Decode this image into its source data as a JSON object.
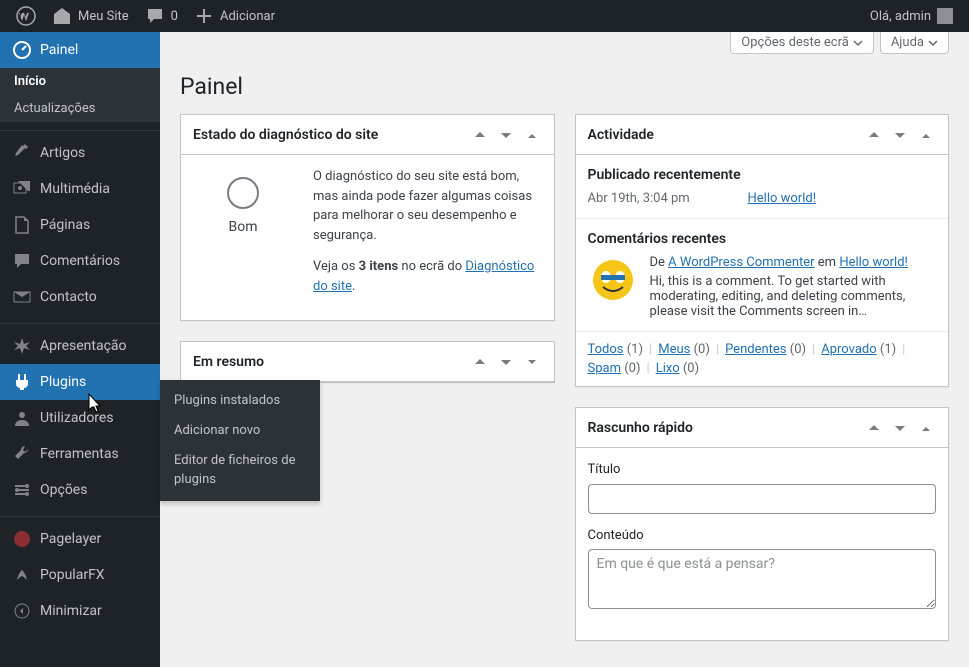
{
  "adminbar": {
    "site_name": "Meu Site",
    "comments_count": "0",
    "add_new": "Adicionar",
    "greeting": "Olá, admin"
  },
  "menu": {
    "dashboard": "Painel",
    "dashboard_sub": {
      "home": "Início",
      "updates": "Actualizações"
    },
    "posts": "Artigos",
    "media": "Multimédia",
    "pages": "Páginas",
    "comments": "Comentários",
    "contact": "Contacto",
    "appearance": "Apresentação",
    "plugins": "Plugins",
    "plugins_sub": {
      "installed": "Plugins instalados",
      "add": "Adicionar novo",
      "editor": "Editor de ficheiros de plugins"
    },
    "users": "Utilizadores",
    "tools": "Ferramentas",
    "settings": "Opções",
    "pagelayer": "Pagelayer",
    "popularfx": "PopularFX",
    "collapse": "Minimizar"
  },
  "screen_meta": {
    "options": "Opções deste ecrã",
    "help": "Ajuda"
  },
  "page_title": "Painel",
  "site_health": {
    "heading": "Estado do diagnóstico do site",
    "status_label": "Bom",
    "desc": "O diagnóstico do seu site está bom, mas ainda pode fazer algumas coisas para melhorar o seu desempenho e segurança.",
    "see_prefix": "Veja os ",
    "see_count": "3 itens",
    "see_mid": " no ecrã do ",
    "see_link": "Diagnóstico do site",
    "see_suffix": "."
  },
  "at_a_glance": {
    "heading": "Em resumo"
  },
  "activity": {
    "heading": "Actividade",
    "recently_published": "Publicado recentemente",
    "pub_date": "Abr 19th, 3:04 pm",
    "pub_title": "Hello world!",
    "recent_comments": "Comentários recentes",
    "comment_by": "De ",
    "comment_author": "A WordPress Commenter",
    "comment_on": " em ",
    "comment_post": "Hello world!",
    "comment_text": "Hi, this is a comment. To get started with moderating, editing, and deleting comments, please visit the Comments screen in…",
    "filters": {
      "all": "Todos",
      "all_n": "(1)",
      "mine": "Meus",
      "mine_n": "(0)",
      "pending": "Pendentes",
      "pending_n": "(0)",
      "approved": "Aprovado",
      "approved_n": "(1)",
      "spam": "Spam",
      "spam_n": "(0)",
      "trash": "Lixo",
      "trash_n": "(0)"
    }
  },
  "quickdraft": {
    "heading": "Rascunho rápido",
    "title_label": "Título",
    "content_label": "Conteúdo",
    "content_placeholder": "Em que é que está a pensar?"
  }
}
